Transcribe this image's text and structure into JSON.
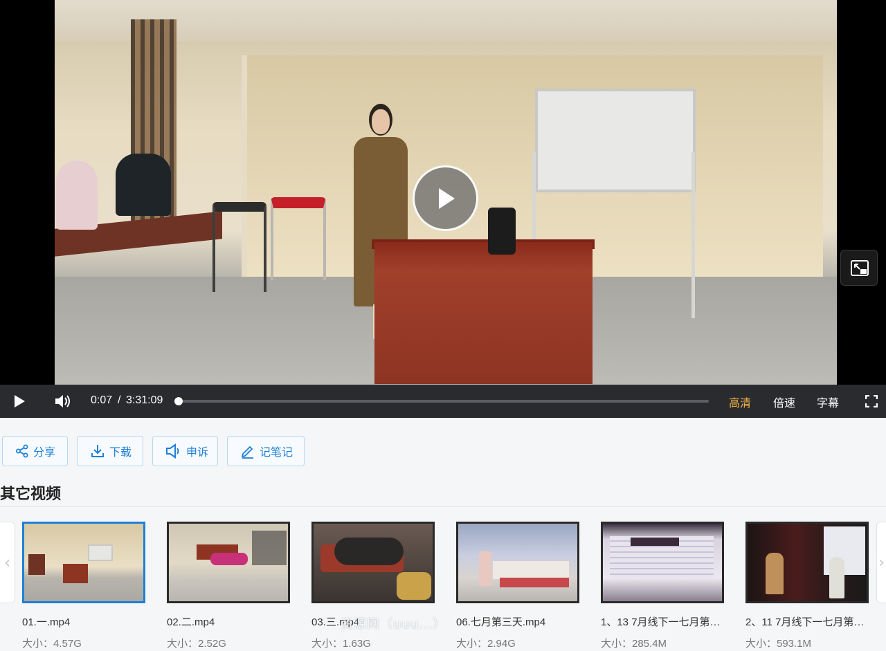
{
  "player": {
    "current_time": "0:07",
    "separator": "/",
    "duration": "3:31:09",
    "progress": 0.0006,
    "quality_label": "高清",
    "speed_label": "倍速",
    "subtitle_label": "字幕",
    "icons": {
      "big_play": "play-icon",
      "play": "play-icon",
      "volume": "volume-icon",
      "fullscreen": "fullscreen-icon",
      "pip": "picture-in-picture-icon"
    }
  },
  "actions": [
    {
      "label": "分享",
      "icon": "share-icon"
    },
    {
      "label": "下载",
      "icon": "download-icon"
    },
    {
      "label": "申诉",
      "icon": "megaphone-icon"
    },
    {
      "label": "记笔记",
      "icon": "pencil-icon"
    }
  ],
  "section_title": "其它视频",
  "videos": [
    {
      "title": "01.一.mp4",
      "size": "大小：4.57G",
      "selected": true
    },
    {
      "title": "02.二.mp4",
      "size": "大小：2.52G",
      "selected": false
    },
    {
      "title": "03.三.mp4",
      "size": "大小：1.63G",
      "selected": false
    },
    {
      "title": "06.七月第三天.mp4",
      "size": "大小：2.94G",
      "selected": false
    },
    {
      "title": "1、13 7月线下一七月第二...",
      "size": "大小：285.4M",
      "selected": false
    },
    {
      "title": "2、11 7月线下一七月第二...",
      "size": "大小：593.1M",
      "selected": false
    }
  ],
  "watermark": "资源网（uuu...）",
  "colors": {
    "accent": "#1e7fd6",
    "quality_active": "#f3b54a",
    "control_bar": "#2a2b2e"
  }
}
